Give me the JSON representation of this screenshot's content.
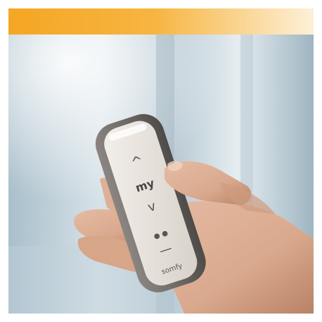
{
  "banner": {
    "gradient_start": "#F5A623",
    "gradient_mid": "#F7B541",
    "gradient_end": "#FDF0D8"
  },
  "remote": {
    "buttons": {
      "up": "^",
      "my": "my",
      "down": "v",
      "preset_dots": "● ●",
      "stop_bar": "—",
      "brand": "somfy"
    },
    "body_color": "#6E6A66",
    "face_color": "#E9E4DF"
  },
  "scene": {
    "background_color": "#C8D6DE",
    "skin_color": "#D9A98E"
  }
}
